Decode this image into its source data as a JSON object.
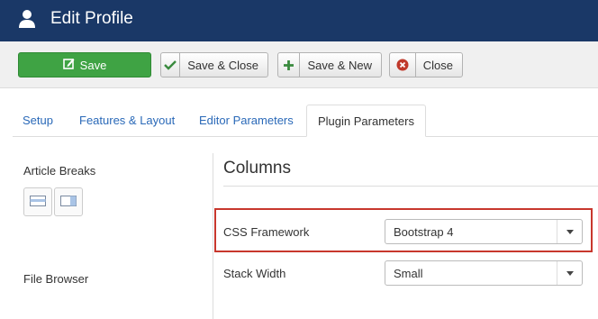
{
  "header": {
    "title": "Edit Profile",
    "icon": "user-icon"
  },
  "toolbar": {
    "save_label": "Save",
    "save_close_label": "Save & Close",
    "save_new_label": "Save & New",
    "close_label": "Close"
  },
  "tabs": [
    {
      "label": "Setup",
      "active": false
    },
    {
      "label": "Features & Layout",
      "active": false
    },
    {
      "label": "Editor Parameters",
      "active": false
    },
    {
      "label": "Plugin Parameters",
      "active": true
    }
  ],
  "left": {
    "article_breaks_label": "Article Breaks",
    "file_browser_label": "File Browser"
  },
  "columns": {
    "title": "Columns",
    "fields": [
      {
        "label": "CSS Framework",
        "value": "Bootstrap 4"
      },
      {
        "label": "Stack Width",
        "value": "Small"
      }
    ]
  },
  "colors": {
    "header_bg": "#1a3867",
    "save_green": "#3fa344",
    "highlight_red": "#c8372d",
    "link_blue": "#2a69b8"
  }
}
